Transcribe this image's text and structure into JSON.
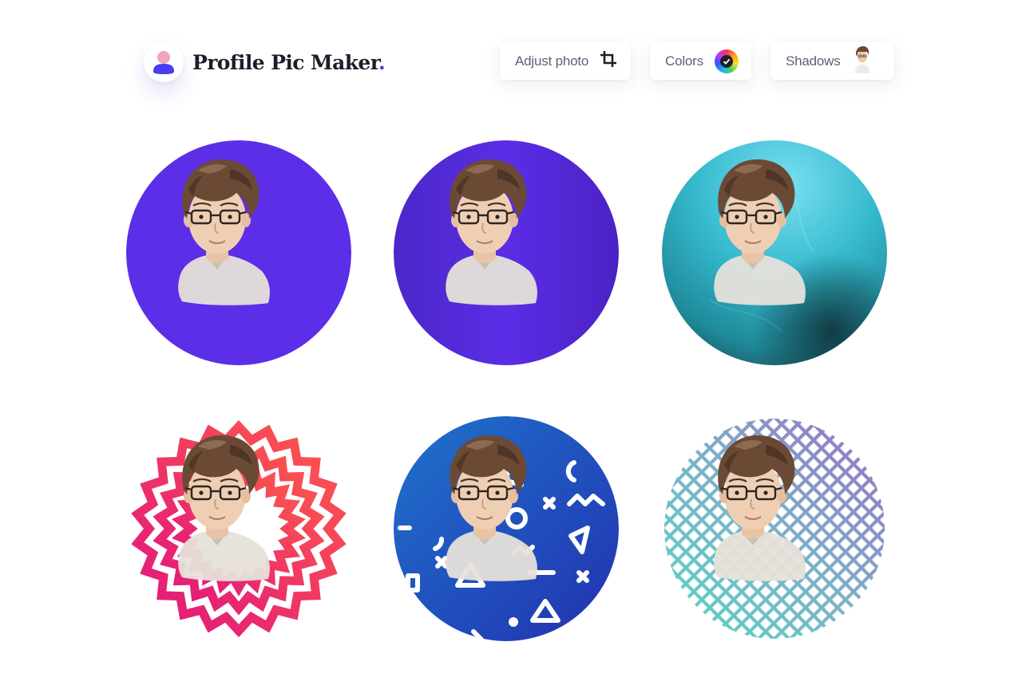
{
  "brand": {
    "name": "Profile Pic Maker",
    "dot": ".",
    "accent": "#5b2ee6"
  },
  "toolbar": {
    "adjust_label": "Adjust photo",
    "colors_label": "Colors",
    "shadows_label": "Shadows"
  },
  "icons": {
    "logo": "user-avatar-icon",
    "adjust": "crop-icon",
    "colors": "color-wheel-icon",
    "shadows": "person-thumbnail-icon"
  },
  "previews": [
    {
      "style": "solid",
      "color": "#5c2ee8"
    },
    {
      "style": "gradient",
      "colors": [
        "#4a27c9",
        "#5c2ee8"
      ]
    },
    {
      "style": "textured",
      "colors": [
        "#6fd8ea",
        "#2ab4c8",
        "#1f5a64"
      ]
    },
    {
      "style": "zigzag-rings",
      "colors": [
        "#ff4f4f",
        "#e51b7a"
      ]
    },
    {
      "style": "memphis-pattern",
      "colors": [
        "#1f6fc9",
        "#2034b0"
      ]
    },
    {
      "style": "diamond-pattern",
      "colors": [
        "#5fd3c8",
        "#8a6fc2"
      ]
    }
  ]
}
